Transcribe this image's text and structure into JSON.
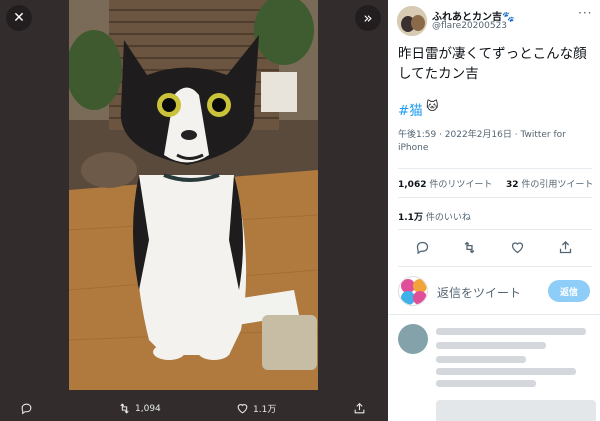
{
  "viewer": {
    "close_icon": "close-icon",
    "expand_icon": "chevrons-right-icon",
    "actions": {
      "reply_icon": "reply-icon",
      "retweet_icon": "retweet-icon",
      "retweet_count": "1,094",
      "like_icon": "heart-icon",
      "like_count": "1.1万",
      "share_icon": "share-icon"
    }
  },
  "tweet": {
    "author_name": "ふれあとカン吉🐾",
    "author_handle": "@flare20200523",
    "more_icon": "···",
    "text": "昨日雷が凄くてずっとこんな顔してたカン吉",
    "hashtag": "#猫",
    "hashtag_emoji": "🐱",
    "timestamp": "午後1:59 · 2022年2月16日 · Twitter for iPhone",
    "retweets_count": "1,062",
    "retweets_label": " 件のリツイート",
    "quotes_count": "32",
    "quotes_label": " 件の引用ツイート",
    "likes_count": "1.1万",
    "likes_label": " 件のいいね"
  },
  "reply_box": {
    "placeholder": "返信をツイート",
    "button_label": "返信"
  },
  "colors": {
    "accent": "#1d9bf0",
    "reply_button": "#8ecdf7",
    "viewer_bg": "#332c2d"
  }
}
